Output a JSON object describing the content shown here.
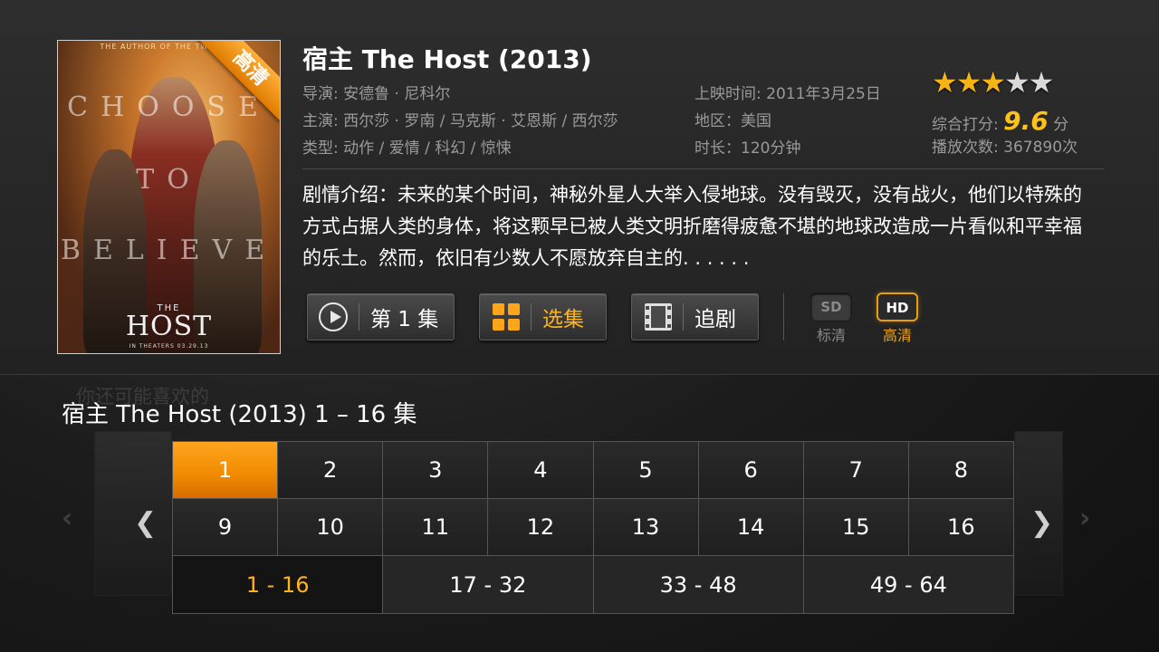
{
  "poster": {
    "author_line": "THE AUTHOR OF THE TWILIGHT",
    "tagline_words": [
      "CHOOSE",
      "TO",
      "BELIEVE"
    ],
    "the": "THE",
    "host": "HOST",
    "in_theaters": "IN THEATERS 03.29.13",
    "badge": "高清"
  },
  "movie": {
    "title": "宿主 The Host (2013)",
    "director": "导演: 安德鲁 · 尼科尔",
    "cast": "主演: 西尔莎 · 罗南 / 马克斯 · 艾恩斯 / 西尔莎",
    "genre": "类型: 动作 / 爱情 / 科幻 / 惊悚",
    "release": "上映时间: 2011年3月25日",
    "region": "地区：美国",
    "duration": "时长：120分钟",
    "rating_stars": 3,
    "rating_max": 5,
    "score_label": "综合打分:",
    "score": "9.6",
    "score_unit": "分",
    "plays": "播放次数: 367890次",
    "description": "剧情介绍：未来的某个时间，神秘外星人大举入侵地球。没有毁灭，没有战火，他们以特殊的方式占据人类的身体，将这颗早已被人类文明折磨得疲惫不堪的地球改造成一片看似和平幸福的乐土。然而，依旧有少数人不愿放弃自主的. . . . . ."
  },
  "actions": {
    "play_label": "第 1 集",
    "select_label": "选集",
    "follow_label": "追剧"
  },
  "quality": {
    "sd_badge": "SD",
    "sd_label": "标清",
    "hd_badge": "HD",
    "hd_label": "高清",
    "selected": "HD"
  },
  "episodes": {
    "header_ghost": "你还可能喜欢的",
    "title": "宿主 The Host (2013) 1 – 16 集",
    "selected": "1",
    "rows": [
      [
        "1",
        "2",
        "3",
        "4",
        "5",
        "6",
        "7",
        "8"
      ],
      [
        "9",
        "10",
        "11",
        "12",
        "13",
        "14",
        "15",
        "16"
      ]
    ],
    "ranges": [
      "1 - 16",
      "17 - 32",
      "33 - 48",
      "49 - 64"
    ],
    "selected_range": "1 - 16",
    "prev_icon": "chevron-left-icon",
    "next_icon": "chevron-right-icon"
  },
  "colors": {
    "accent": "#f6a516",
    "star_on": "#f6b417",
    "star_off": "#d9d9d9",
    "score": "#ffc21a"
  }
}
